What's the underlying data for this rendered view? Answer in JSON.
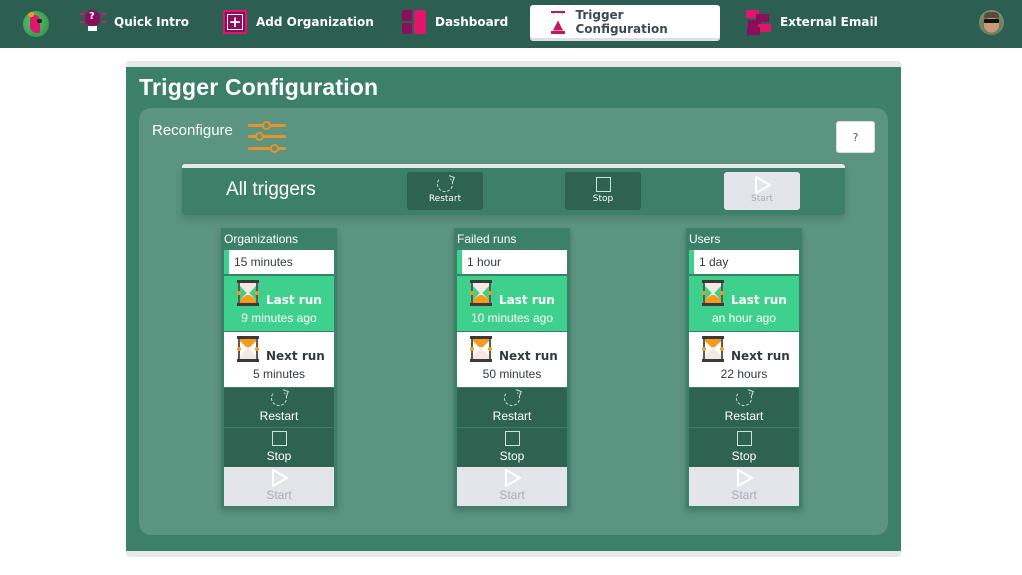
{
  "nav": {
    "items": [
      {
        "label": "Quick Intro",
        "icon": "lightbulb-question-icon"
      },
      {
        "label": "Add Organization",
        "icon": "add-organization-icon"
      },
      {
        "label": "Dashboard",
        "icon": "dashboard-icon"
      },
      {
        "label": "Trigger Configuration",
        "icon": "hourglass-icon",
        "active": true
      },
      {
        "label": "External Email",
        "icon": "envelopes-icon"
      }
    ]
  },
  "page": {
    "title": "Trigger Configuration",
    "reconfigure_label": "Reconfigure",
    "help_label": "?"
  },
  "all_triggers": {
    "label": "All triggers",
    "restart_label": "Restart",
    "stop_label": "Stop",
    "start_label": "Start"
  },
  "triggers": [
    {
      "name": "Organizations",
      "interval": "15 minutes",
      "last_run_label": "Last run",
      "last_run": "9 minutes ago",
      "next_run_label": "Next run",
      "next_run": "5 minutes",
      "restart_label": "Restart",
      "stop_label": "Stop",
      "start_label": "Start"
    },
    {
      "name": "Failed runs",
      "interval": "1 hour",
      "last_run_label": "Last run",
      "last_run": "10 minutes ago",
      "next_run_label": "Next run",
      "next_run": "50 minutes",
      "restart_label": "Restart",
      "stop_label": "Stop",
      "start_label": "Start"
    },
    {
      "name": "Users",
      "interval": "1 day",
      "last_run_label": "Last run",
      "last_run": "an hour ago",
      "next_run_label": "Next run",
      "next_run": "22 hours",
      "restart_label": "Restart",
      "stop_label": "Stop",
      "start_label": "Start"
    }
  ],
  "colors": {
    "topbar": "#2c5f51",
    "accent_green": "#3dd18d",
    "panel": "#5b9480",
    "brand_magenta": "#8b0e5b",
    "brand_pink": "#e0156b",
    "slider_orange": "#e8922a"
  }
}
